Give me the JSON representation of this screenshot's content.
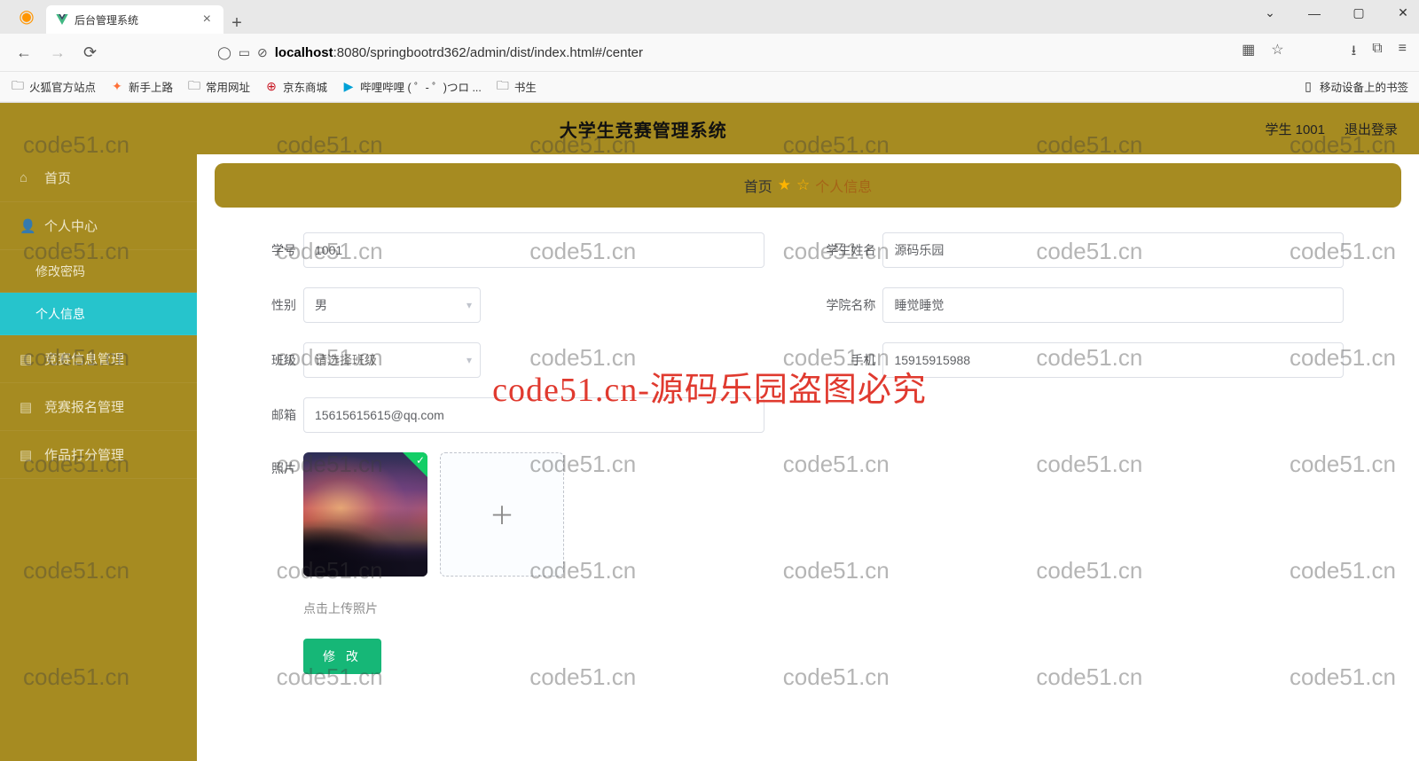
{
  "browser": {
    "tab_title": "后台管理系统",
    "url_prefix": "localhost",
    "url_port_path": ":8080/springbootrd362/admin/dist/index.html#/center",
    "bookmarks": [
      {
        "icon": "folder",
        "label": "火狐官方站点"
      },
      {
        "icon": "rocket",
        "label": "新手上路"
      },
      {
        "icon": "folder",
        "label": "常用网址"
      },
      {
        "icon": "jd",
        "label": "京东商城"
      },
      {
        "icon": "bili",
        "label": "哔哩哔哩 ( ゜- ゜)つロ ..."
      },
      {
        "icon": "folder",
        "label": "书生"
      }
    ],
    "mobile_bookmark": "移动设备上的书签"
  },
  "header": {
    "title": "大学生竞赛管理系统",
    "user": "学生 1001",
    "logout": "退出登录"
  },
  "sidebar": {
    "items": [
      {
        "label": "首页",
        "icon": "home"
      },
      {
        "label": "个人中心",
        "icon": "user"
      },
      {
        "label": "修改密码",
        "sub": true
      },
      {
        "label": "个人信息",
        "sub": true,
        "active": true
      },
      {
        "label": "竞赛信息管理",
        "icon": "doc"
      },
      {
        "label": "竞赛报名管理",
        "icon": "doc"
      },
      {
        "label": "作品打分管理",
        "icon": "doc"
      }
    ]
  },
  "breadcrumb": {
    "home": "首页",
    "current": "个人信息"
  },
  "form": {
    "fields": {
      "student_id": {
        "label": "学号",
        "value": "1001"
      },
      "student_name": {
        "label": "学生姓名",
        "value": "源码乐园"
      },
      "gender": {
        "label": "性别",
        "value": "男"
      },
      "college": {
        "label": "学院名称",
        "value": "睡觉睡觉"
      },
      "class": {
        "label": "班级",
        "placeholder": "请选择班级"
      },
      "phone": {
        "label": "手机",
        "value": "15915915988"
      },
      "email": {
        "label": "邮箱",
        "value": "15615615615@qq.com"
      },
      "photo": {
        "label": "照片"
      }
    },
    "upload_tip": "点击上传照片",
    "submit": "修 改"
  },
  "watermark": {
    "small": "code51.cn",
    "big": "code51.cn-源码乐园盗图必究"
  }
}
